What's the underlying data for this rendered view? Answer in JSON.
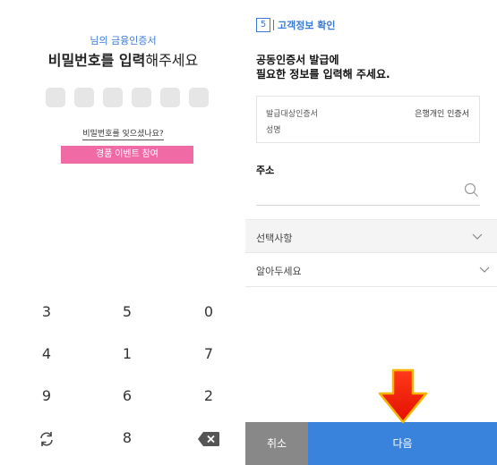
{
  "left": {
    "cert_subtitle": "님의 금융인증서",
    "title_bold": "비밀번호를 입력",
    "title_rest": "해주세요",
    "pin_slots": 6,
    "forgot_link": "비밀번호를 잊으셨나요?",
    "event_button": "경품 이벤트 참여",
    "keypad": [
      "3",
      "5",
      "0",
      "4",
      "1",
      "7",
      "9",
      "6",
      "2",
      "",
      "8",
      ""
    ],
    "accent_pink": "#f06aa6",
    "accent_blue": "#3b7bd8"
  },
  "right": {
    "step_number": "5",
    "step_label": "고객정보 확인",
    "headline_line1": "공동인증서 발급에",
    "headline_line2": "필요한 정보를 입력해 주세요.",
    "info": {
      "row1_label": "발급대상인증서",
      "row1_value": "은행개인 인증서",
      "row2_label": "성명"
    },
    "address_label": "주소",
    "address_value": "",
    "section_optional": "선택사항",
    "section_notice": "알아두세요",
    "cancel_button": "취소",
    "next_button": "다음",
    "next_color": "#3a83dc",
    "cancel_color": "#888888"
  }
}
